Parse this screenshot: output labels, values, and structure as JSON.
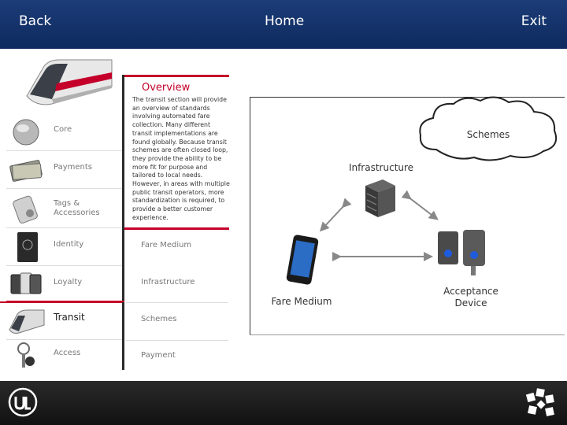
{
  "nav": {
    "back": "Back",
    "home": "Home",
    "exit": "Exit"
  },
  "sidebar": {
    "items": [
      {
        "label": "Core",
        "icon": "core-sphere-icon"
      },
      {
        "label": "Payments",
        "icon": "cash-icon"
      },
      {
        "label": "Tags & Accessories",
        "icon": "tags-icon"
      },
      {
        "label": "Identity",
        "icon": "passport-icon"
      },
      {
        "label": "Loyalty",
        "icon": "loyalty-cards-icon"
      },
      {
        "label": "Transit",
        "icon": "train-icon",
        "active": true
      },
      {
        "label": "Access",
        "icon": "keys-icon"
      }
    ]
  },
  "overview": {
    "title": "Overview",
    "text": "The transit section will provide an overview of standards involving automated fare collection. Many different transit implementations are found globally. Because transit schemes are often closed loop, they provide the ability to be more fit for purpose and tailored to local needs. However, in areas with multiple public transit operators, more standardization is required, to provide a better customer experience."
  },
  "subnav": [
    "Fare Medium",
    "Infrastructure",
    "Schemes",
    "Payment"
  ],
  "diagram": {
    "schemes": "Schemes",
    "infrastructure": "Infrastructure",
    "fare_medium": "Fare Medium",
    "acceptance_device": "Acceptance Device"
  },
  "colors": {
    "accent": "#c4002a",
    "topbar": "#143470",
    "bottombar": "#1e1e1e"
  }
}
